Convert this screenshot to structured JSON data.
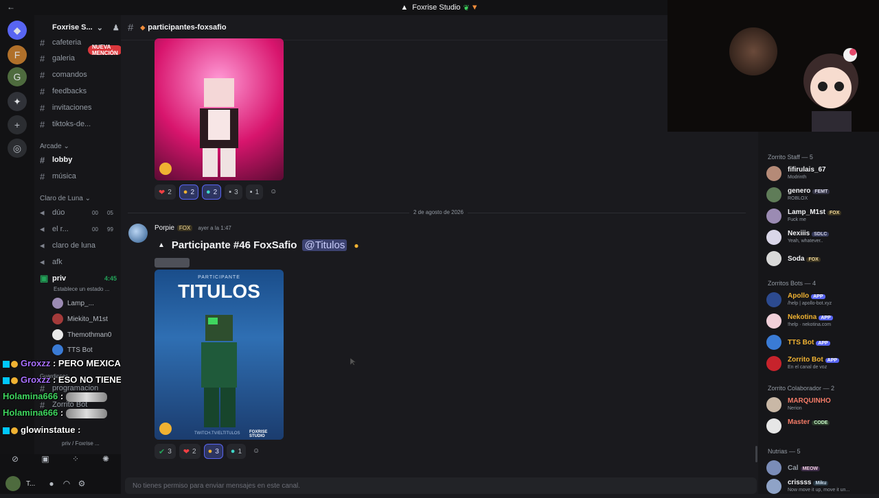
{
  "window": {
    "title": "Foxrise Studio"
  },
  "server": {
    "name": "Foxrise S...",
    "new_mention": "NUEVA MENCIÓN",
    "channels": [
      {
        "name": "cafeteria"
      },
      {
        "name": "galeria"
      },
      {
        "name": "comandos"
      },
      {
        "name": "feedbacks"
      },
      {
        "name": "invitaciones"
      },
      {
        "name": "tiktoks-de..."
      }
    ],
    "category_arcade": "Arcade",
    "arcade_channels": [
      {
        "name": "lobby"
      },
      {
        "name": "música"
      }
    ],
    "category_claro": "Claro de Luna",
    "voice_channels": [
      {
        "name": "dúo",
        "count_a": "00",
        "count_b": "05"
      },
      {
        "name": "el r...",
        "count_a": "00",
        "count_b": "99"
      },
      {
        "name": "claro de luna"
      },
      {
        "name": "afk"
      },
      {
        "name": "priv",
        "time": "4:45",
        "status": "Establece un estado ..."
      }
    ],
    "voice_users": [
      {
        "name": "Lamp_..."
      },
      {
        "name": "Miekito_M1st"
      },
      {
        "name": "Themothman0"
      },
      {
        "name": "TTS Bot"
      }
    ],
    "more_channels": [
      {
        "name": "Guardianes"
      },
      {
        "name": "programacion"
      },
      {
        "name": "Zorrito Bot"
      }
    ],
    "user_panel": {
      "voice_label": "priv / Foxrise ...",
      "user_short": "T..."
    }
  },
  "stream_chat": [
    {
      "user": "Groxzz",
      "text": "PERO MEXICAN",
      "color": "#a970ff"
    },
    {
      "user": "Groxzz",
      "text": "ESO NO TIENE SENTIDO",
      "color": "#a970ff"
    },
    {
      "user": "Holamina666",
      "text": ":",
      "color": "#3fd65f"
    },
    {
      "user": "Holamina666",
      "text": ":",
      "color": "#3fd65f"
    },
    {
      "user": "glowinstatue",
      "text": ":",
      "color": "#ffffff"
    }
  ],
  "channel": {
    "name": "participantes-foxsafio"
  },
  "messages": {
    "first_reactions": [
      {
        "emoji": "❤",
        "count": "2",
        "on": false
      },
      {
        "emoji": "●",
        "count": "2",
        "on": true
      },
      {
        "emoji": "●",
        "count": "2",
        "on": true
      },
      {
        "emoji": "▪",
        "count": "3",
        "on": false
      },
      {
        "emoji": "▪",
        "count": "1",
        "on": false
      }
    ],
    "date_divider": "2 de agosto de 2026",
    "second": {
      "author": "Porpie",
      "tag": "FOX",
      "time": "ayer a la 1:47",
      "title": "Participante #46 FoxSafio",
      "mention": "@Titulos",
      "image_header": "PARTICIPANTE",
      "image_title": "TITULOS",
      "image_footer": "TWITCH.TV/ELTITULOS",
      "brand": "FOXRISE STUDIO",
      "reactions": [
        {
          "emoji": "✔",
          "count": "3",
          "on": false
        },
        {
          "emoji": "❤",
          "count": "2",
          "on": false
        },
        {
          "emoji": "●",
          "count": "3",
          "on": true
        },
        {
          "emoji": "●",
          "count": "1",
          "on": false
        }
      ]
    }
  },
  "composer": {
    "placeholder": "No tienes permiso para enviar mensajes en este canal."
  },
  "members": {
    "groups": [
      {
        "title": "Zorrito Staff — 5",
        "members": [
          {
            "name": "fifirulais_67",
            "status": "Modrinth",
            "color": "#f2f3f5"
          },
          {
            "name": "genero",
            "tag": "FEMT",
            "status": "ROBLOX",
            "color": "#f2f3f5"
          },
          {
            "name": "Lamp_M1st",
            "tag": "FOX",
            "status": "Fuck me",
            "color": "#f2f3f5"
          },
          {
            "name": "Nexiiis",
            "tag": "SDLC",
            "status": "Yeah, whatever..",
            "color": "#f2f3f5"
          },
          {
            "name": "Soda",
            "tag": "FOX",
            "status": "",
            "color": "#f2f3f5"
          }
        ]
      },
      {
        "title": "Zorritos Bots — 4",
        "members": [
          {
            "name": "Apollo",
            "tag": "APP",
            "status": "/help | apollo-bot.xyz",
            "color": "#f0b232"
          },
          {
            "name": "Nekotina",
            "tag": "APP",
            "status": "!help · nekotina.com",
            "color": "#f0b232"
          },
          {
            "name": "TTS Bot",
            "tag": "APP",
            "status": "",
            "color": "#f0b232"
          },
          {
            "name": "Zorrito Bot",
            "tag": "APP",
            "status": "En el canal de voz",
            "color": "#f0b232"
          }
        ]
      },
      {
        "title": "Zorrito Colaborador — 2",
        "members": [
          {
            "name": "MARQUINHO",
            "status": "Nerion",
            "color": "#f47b67"
          },
          {
            "name": "Master",
            "tag": "CODE",
            "status": "",
            "color": "#f47b67"
          }
        ]
      },
      {
        "title": "Nutrias — 5",
        "members": [
          {
            "name": "Cal",
            "tag": "MEOW",
            "status": "",
            "color": "#949ba4"
          },
          {
            "name": "crissss",
            "tag": "Miku",
            "status": "Now move it up, move it un...",
            "color": "#f2f3f5"
          }
        ]
      }
    ]
  },
  "colors": {
    "background": "#1a1a1e",
    "sidebar": "#161619",
    "accent": "#5865f2",
    "online": "#23a55a"
  }
}
